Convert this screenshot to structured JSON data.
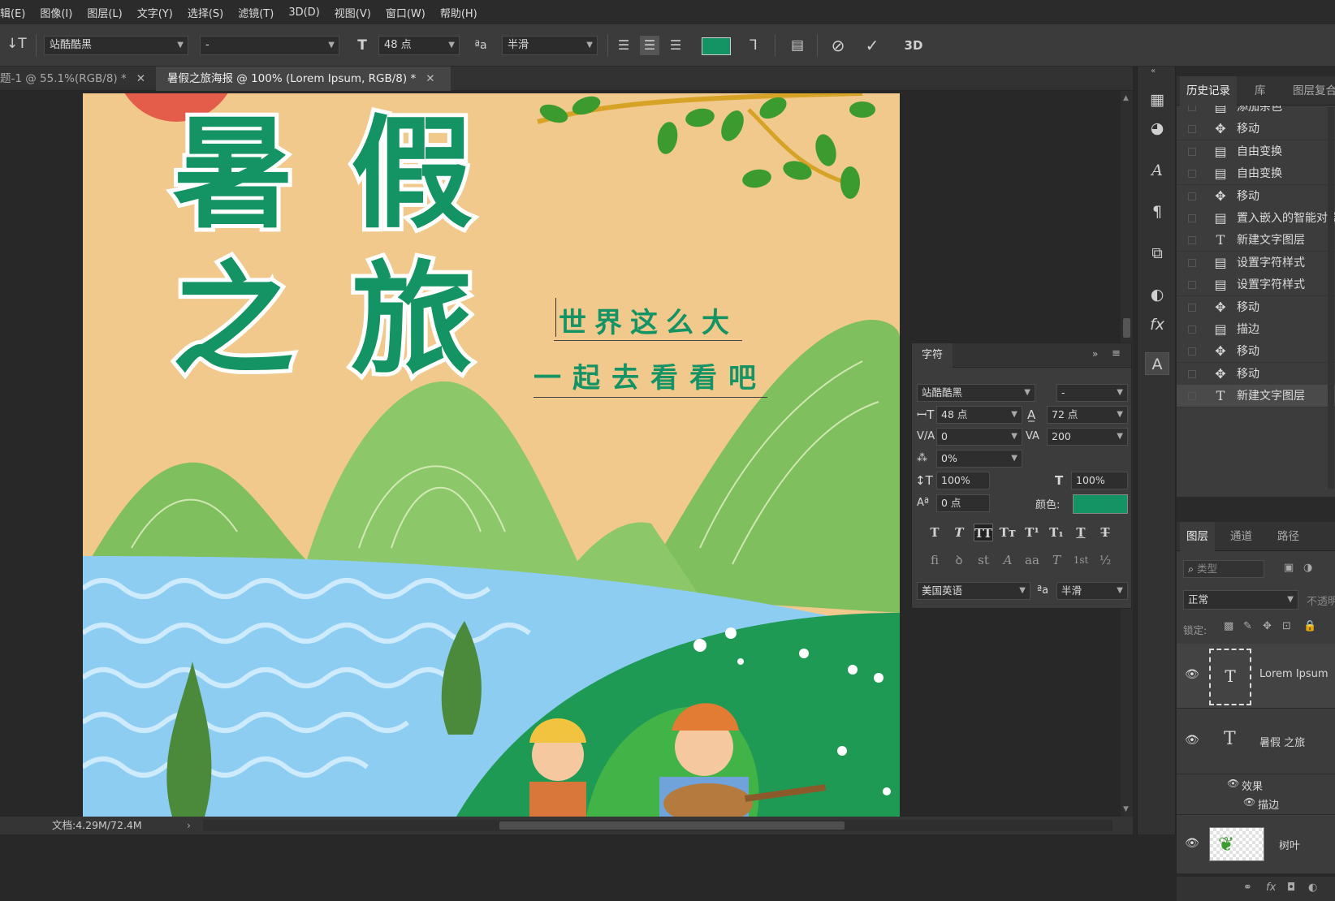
{
  "menu": [
    "辑(E)",
    "图像(I)",
    "图层(L)",
    "文字(Y)",
    "选择(S)",
    "滤镜(T)",
    "3D(D)",
    "视图(V)",
    "窗口(W)",
    "帮助(H)"
  ],
  "options": {
    "font_family": "站酷酷黑",
    "font_style": "-",
    "font_size": "48 点",
    "antialias": "半滑",
    "color": "#149364"
  },
  "tabs": [
    {
      "label": "题-1 @ 55.1%(RGB/8) *"
    },
    {
      "label": "暑假之旅海报 @ 100% (Lorem Ipsum, RGB/8) *"
    }
  ],
  "poster": {
    "title_line1_a": "暑",
    "title_line1_b": "假",
    "title_line2_a": "之",
    "title_line2_b": "旅",
    "subtitle1": "世界这么大",
    "subtitle2": "一起去看看吧"
  },
  "status": {
    "doc": "文档:4.29M/72.4M"
  },
  "history_panel": {
    "tabs": [
      "历史记录",
      "库",
      "图层复合"
    ],
    "items": [
      {
        "icon": "doc-icon",
        "label": "添加杂色"
      },
      {
        "icon": "move-icon",
        "label": "移动"
      },
      {
        "icon": "doc-icon",
        "label": "自由变换"
      },
      {
        "icon": "doc-icon",
        "label": "自由变换"
      },
      {
        "icon": "move-icon",
        "label": "移动"
      },
      {
        "icon": "doc-icon",
        "label": "置入嵌入的智能对象"
      },
      {
        "icon": "type-icon",
        "label": "新建文字图层"
      },
      {
        "icon": "doc-icon",
        "label": "设置字符样式"
      },
      {
        "icon": "doc-icon",
        "label": "设置字符样式"
      },
      {
        "icon": "move-icon",
        "label": "移动"
      },
      {
        "icon": "doc-icon",
        "label": "描边"
      },
      {
        "icon": "move-icon",
        "label": "移动"
      },
      {
        "icon": "move-icon",
        "label": "移动"
      },
      {
        "icon": "type-icon",
        "label": "新建文字图层"
      }
    ]
  },
  "character_panel": {
    "title": "字符",
    "font_family": "站酷酷黑",
    "font_style": "-",
    "size": "48 点",
    "leading": "72 点",
    "kerning": "0",
    "tracking": "200",
    "scale_pct": "0%",
    "vscale": "100%",
    "hscale": "100%",
    "baseline": "0 点",
    "color_label": "颜色:",
    "color": "#149364",
    "language": "美国英语",
    "aa_label": "半滑",
    "style_buttons": [
      "T",
      "T",
      "TT",
      "Tт",
      "T¹",
      "T₁",
      "T",
      "T"
    ],
    "ot_buttons": [
      "fi",
      "ꝺ",
      "st",
      "A",
      "aa",
      "T",
      "1st",
      "½"
    ]
  },
  "layers_panel": {
    "tabs": [
      "图层",
      "通道",
      "路径"
    ],
    "filter_placeholder": "类型",
    "blend_mode": "正常",
    "opacity_label": "不透明",
    "lock_label": "锁定:",
    "layers": [
      {
        "name": "Lorem Ipsum",
        "type": "text"
      },
      {
        "name": "暑假 之旅",
        "type": "text"
      },
      {
        "name": "效果",
        "type": "effect"
      },
      {
        "name": "描边",
        "type": "effect-item"
      },
      {
        "name": "树叶",
        "type": "image"
      }
    ]
  }
}
